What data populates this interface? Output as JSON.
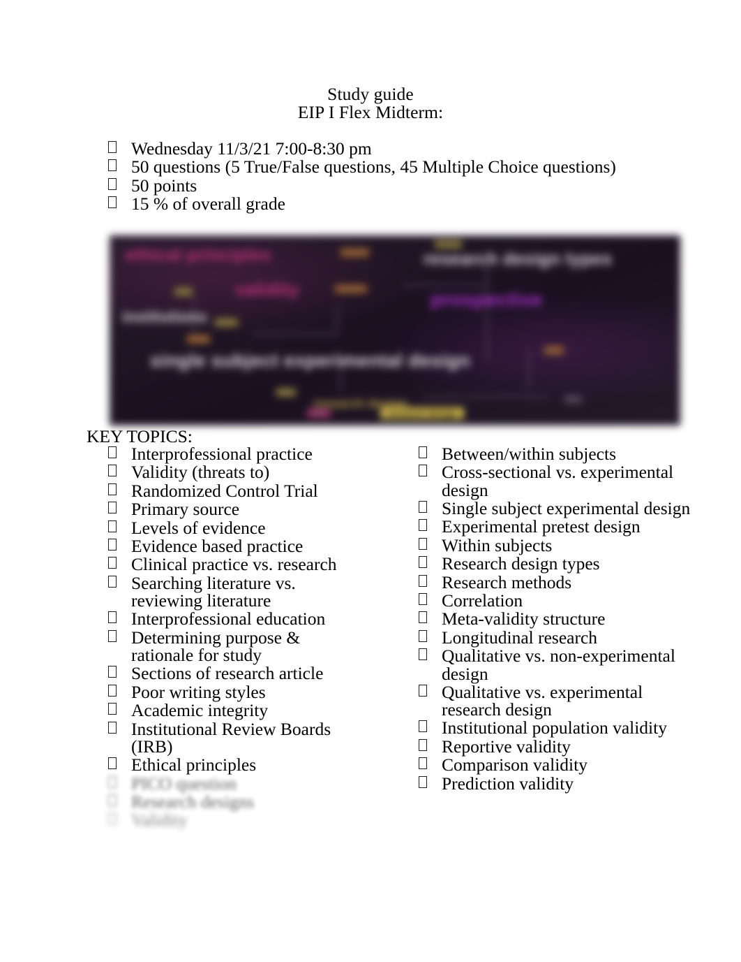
{
  "document": {
    "title_lines": [
      "Study guide",
      "EIP I Flex Midterm:"
    ],
    "exam_details": [
      "Wednesday 11/3/21 7:00-8:30 pm",
      "50 questions (5 True/False questions, 45 Multiple Choice questions)",
      "50 points",
      "15 % of overall grade"
    ],
    "key_topics_heading": "KEY TOPICS:",
    "topics_left": [
      "Interprofessional practice",
      "Validity (threats to)",
      "Randomized Control Trial",
      "Primary source",
      "Levels of evidence",
      "Evidence based practice",
      "Clinical practice vs. research",
      "Searching literature vs. reviewing literature",
      "Interprofessional education",
      "Determining purpose & rationale for study",
      "Sections of research article",
      "Poor writing styles",
      "Academic integrity",
      "Institutional Review Boards (IRB)",
      "Ethical principles",
      "PICO question",
      "Research designs",
      "Validity"
    ],
    "topics_right": [
      "Between/within subjects",
      "Cross-sectional vs. experimental design",
      "Single subject experimental design",
      "Experimental pretest design",
      "Within subjects",
      "Research design types",
      "Research methods",
      "Correlation",
      "Meta-validity structure",
      "Longitudinal research",
      "Qualitative vs. non-experimental design",
      "Qualitative vs. experimental research design",
      "Institutional population validity",
      "Reportive validity",
      "Comparison validity",
      "Prediction validity"
    ],
    "figure": {
      "alt": "Blurred dark concept map diagram of research design terms",
      "background_color": "#1b1220",
      "nodes": [
        {
          "text": "ethical principles",
          "color": "#c1337b"
        },
        {
          "text": "validity",
          "color": "#c1337b"
        },
        {
          "text": "institutions",
          "color": "#d8d5da"
        },
        {
          "text": "research design types",
          "color": "#d8d5da"
        },
        {
          "text": "prospective",
          "color": "#ab2fcb"
        },
        {
          "text": "single subject experimental design",
          "color": "#d8d5da"
        },
        {
          "text": "research design",
          "color": "#c9b24a"
        }
      ],
      "chips": [
        {
          "text": "includes",
          "color": "#6e6030"
        },
        {
          "text": "used",
          "color": "#6e6030"
        },
        {
          "text": "proves",
          "color": "#6e6030"
        },
        {
          "text": "types",
          "color": "#6e6030"
        },
        {
          "text": "research",
          "color": "#7a4a22"
        },
        {
          "text": "measures",
          "color": "#7a4a22"
        },
        {
          "text": "design",
          "color": "#7a4a22"
        },
        {
          "text": "study",
          "color": "#7a4a22"
        },
        {
          "text": "related",
          "color": "#7d2352"
        },
        {
          "text": "kinds",
          "color": "#3a2d3f"
        }
      ]
    }
  }
}
